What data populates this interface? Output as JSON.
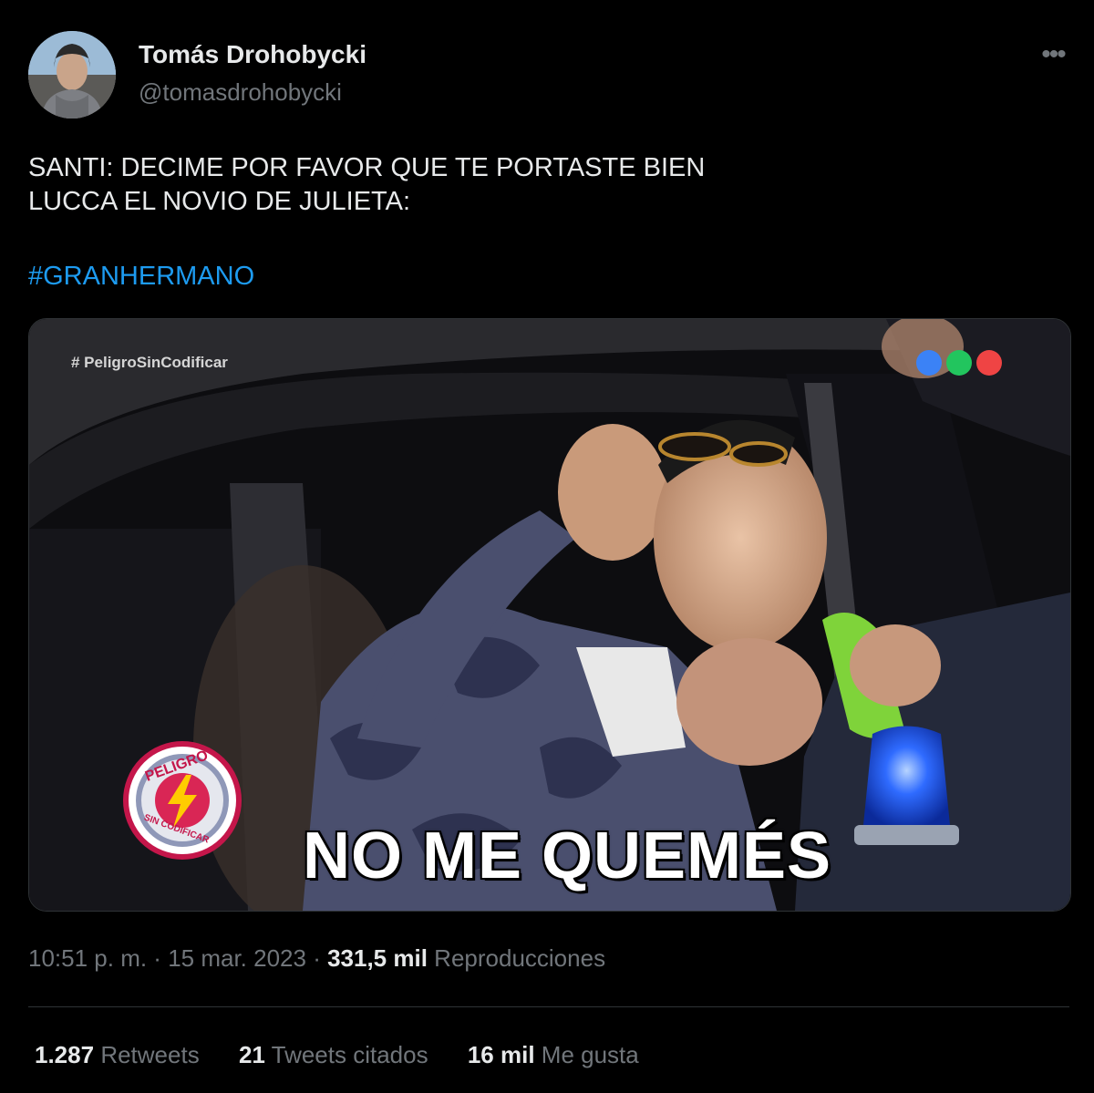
{
  "author": {
    "display_name": "Tomás Drohobycki",
    "handle": "@tomasdrohobycki",
    "avatar_icon": "profile-photo"
  },
  "more_icon": "ellipsis-icon",
  "tweet": {
    "lines": [
      "SANTI: DECIME POR FAVOR QUE TE PORTASTE BIEN",
      "LUCCA EL NOVIO DE JULIETA:"
    ],
    "hashtag": "#GRANHERMANO"
  },
  "media": {
    "watermark": "# PeligroSinCodificar",
    "caption": "NO ME QUEMÉS",
    "badge_top": "PELIGRO",
    "badge_bottom": "SIN CODIFICAR",
    "channel_logo_colors": [
      "#3b82f6",
      "#22c55e",
      "#ef4444"
    ]
  },
  "meta": {
    "time": "10:51 p. m.",
    "separator": " · ",
    "date": "15 mar. 2023",
    "views_count": "331,5 mil",
    "views_label": "Reproducciones"
  },
  "stats": {
    "retweets_count": "1.287",
    "retweets_label": "Retweets",
    "quotes_count": "21",
    "quotes_label": "Tweets citados",
    "likes_count": "16 mil",
    "likes_label": "Me gusta"
  },
  "colors": {
    "background": "#000000",
    "text": "#e7e9ea",
    "secondary": "#71767b",
    "link": "#1d9bf0"
  }
}
